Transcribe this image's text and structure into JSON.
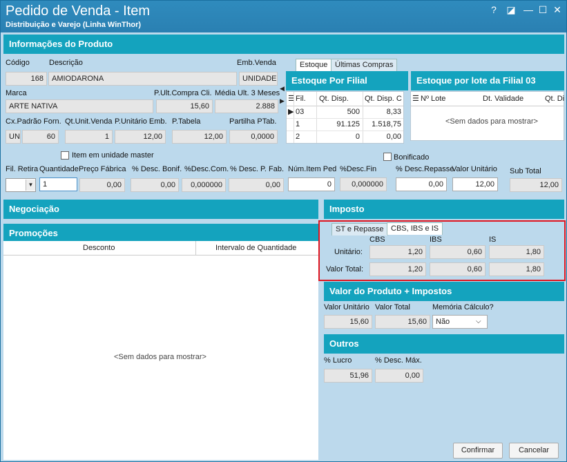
{
  "window": {
    "title": "Pedido de Venda - Item",
    "subtitle": "Distribuição e Varejo (Linha WinThor)",
    "btn_help": "?",
    "btn_minimize": "—",
    "btn_maximize": "☐",
    "btn_close": "✕"
  },
  "sections": {
    "info": "Informações do Produto",
    "estoque_filial": "Estoque Por Filial",
    "estoque_lote": "Estoque por lote da Filial 03",
    "negociacao": "Negociação",
    "imposto": "Imposto",
    "promocoes": "Promoções",
    "valor_prod": "Valor do Produto + Impostos",
    "outros": "Outros"
  },
  "produto": {
    "codigo_label": "Código",
    "codigo": "168",
    "descricao_label": "Descrição",
    "descricao": "AMIODARONA",
    "emb_label": "Emb.Venda",
    "emb": "UNIDADE",
    "marca_label": "Marca",
    "marca": "ARTE NATIVA",
    "pult_label": "P.Ult.Compra Cli.",
    "pult": "15,60",
    "media_label": "Média Ult. 3 Meses",
    "media": "2.888",
    "cxpadrao_label": "Cx.Padrão Forn.",
    "cx_un": "UN",
    "cx_val": "60",
    "qtunit_label": "Qt.Unit.Venda",
    "qtunit": "1",
    "punit_emb_label": "P.Unitário Emb.",
    "punit_emb": "12,00",
    "ptabela_label": "P.Tabela",
    "ptabela": "12,00",
    "partilha_label": "Partilha PTab.",
    "partilha": "0,0000",
    "item_master": "Item em unidade master",
    "bonificado": "Bonificado"
  },
  "linha": {
    "fil_label": "Fil. Retira",
    "fil": "",
    "qtd_label": "Quantidade",
    "qtd": "1",
    "pfab_label": "Preço Fábrica",
    "pfab": "0,00",
    "descbonif_label": "% Desc. Bonif.",
    "descbonif": "0,00",
    "desccom_label": "%Desc.Com.",
    "desccom": "0,000000",
    "descpfab_label": "% Desc. P. Fab.",
    "descpfab": "0,00",
    "numitem_label": "Núm.Item Ped",
    "numitem": "0",
    "descfin_label": "%Desc.Fin",
    "descfin": "0,000000",
    "descrep_label": "% Desc.Repasse",
    "descrep": "0,00",
    "vunit_label": "Valor Unitário",
    "vunit": "12,00",
    "subtotal_label": "Sub Total",
    "subtotal": "12,00"
  },
  "estoque_tabs": [
    "Estoque",
    "Últimas Compras"
  ],
  "estoque": {
    "headers": [
      "Fil.",
      "Qt. Disp.",
      "Qt. Disp. C"
    ],
    "rows": [
      [
        "03",
        "500",
        "8,33"
      ],
      [
        "1",
        "91.125",
        "1.518,75"
      ],
      [
        "2",
        "0",
        "0,00"
      ]
    ]
  },
  "lote": {
    "headers": [
      "Nº Lote",
      "Dt. Validade",
      "Qt. Di"
    ],
    "empty": "<Sem dados para mostrar>"
  },
  "promocoes": {
    "headers": [
      "Desconto",
      "Intervalo de Quantidade"
    ],
    "empty": "<Sem dados para mostrar>"
  },
  "imposto_tabs": [
    "ST e Repasse",
    "CBS, IBS e IS"
  ],
  "imposto": {
    "col_cbs": "CBS",
    "col_ibs": "IBS",
    "col_is": "IS",
    "unit_label": "Unitário:",
    "total_label": "Valor Total:",
    "unit": [
      "1,20",
      "0,60",
      "1,80"
    ],
    "total": [
      "1,20",
      "0,60",
      "1,80"
    ]
  },
  "valor_prod": {
    "vunit_label": "Valor Unitário",
    "vunit": "15,60",
    "vtotal_label": "Valor Total",
    "vtotal": "15,60",
    "memoria_label": "Memória Cálculo?",
    "memoria": "Não"
  },
  "outros": {
    "lucro_label": "% Lucro",
    "lucro": "51,96",
    "descmax_label": "% Desc. Máx.",
    "descmax": "0,00"
  },
  "buttons": {
    "confirmar": "Confirmar",
    "cancelar": "Cancelar"
  },
  "colors": {
    "section": "#14a3be",
    "title": "#2f8bbd",
    "highlight": "#e0141e"
  }
}
